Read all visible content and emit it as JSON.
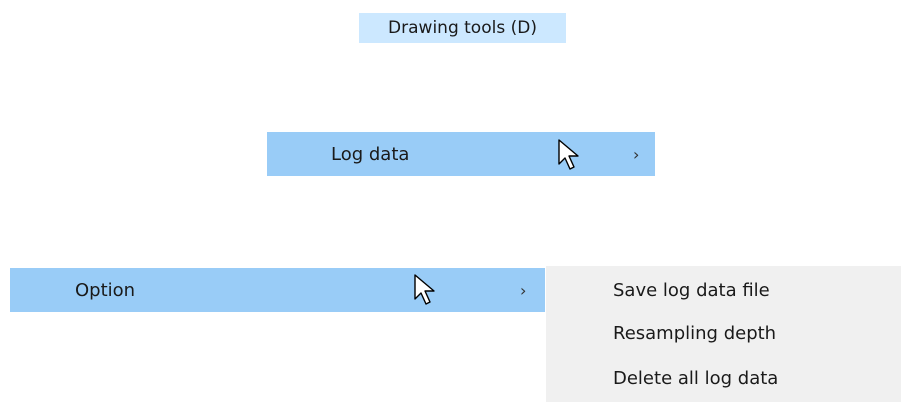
{
  "tab": {
    "label": "Drawing tools (D)"
  },
  "menu": {
    "log_data_label": "Log data",
    "option_label": "Option",
    "chevron": "›"
  },
  "submenu": {
    "items": [
      {
        "label": "Save log data file"
      },
      {
        "label": "Resampling depth"
      },
      {
        "label": "Delete all log data"
      }
    ]
  },
  "colors": {
    "tab_highlight": "#cce8ff",
    "row_highlight": "#99ccf7",
    "submenu_bg": "#f0f0f0"
  },
  "icons": {
    "cursor": "mouse-pointer-icon",
    "submenu_arrow": "chevron-right-icon"
  }
}
